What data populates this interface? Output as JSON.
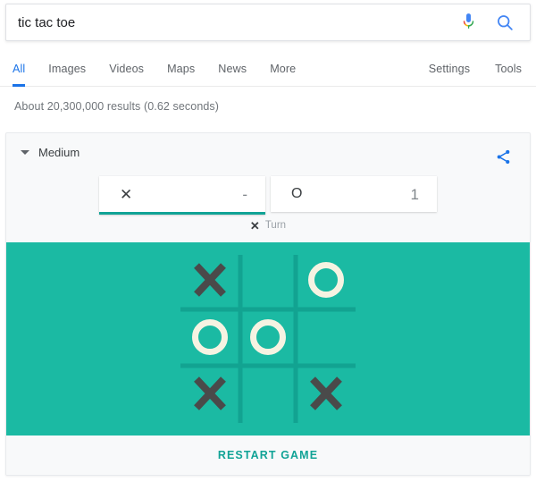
{
  "search": {
    "query": "tic tac toe",
    "placeholder": "Search",
    "mic_icon": "microphone-icon",
    "search_icon": "search-icon"
  },
  "nav": {
    "left_tabs": [
      {
        "label": "All",
        "active": true
      },
      {
        "label": "Images",
        "active": false
      },
      {
        "label": "Videos",
        "active": false
      },
      {
        "label": "Maps",
        "active": false
      },
      {
        "label": "News",
        "active": false
      },
      {
        "label": "More",
        "active": false
      }
    ],
    "right_tabs": [
      {
        "label": "Settings"
      },
      {
        "label": "Tools"
      }
    ]
  },
  "result_stats": "About 20,300,000 results (0.62 seconds)",
  "game": {
    "difficulty": "Medium",
    "difficulty_caret_icon": "chevron-down-icon",
    "share_icon": "share-icon",
    "scores": [
      {
        "mark": "✕",
        "value": "-",
        "active": true,
        "player": "x"
      },
      {
        "mark": "O",
        "value": "1",
        "active": false,
        "player": "o"
      }
    ],
    "turn": {
      "mark": "✕",
      "label": "Turn"
    },
    "board": {
      "cells": [
        "X",
        "",
        "O",
        "O",
        "O",
        "",
        "X",
        "",
        "X"
      ],
      "bg_color": "#1bbaa3",
      "grid_color": "#12a391",
      "x_color": "#4a4a4a",
      "o_color": "#f6f3e2"
    },
    "restart_label": "RESTART GAME"
  },
  "colors": {
    "accent_teal": "#11a396",
    "google_blue": "#1a73e8",
    "text_gray": "#5f6368"
  }
}
